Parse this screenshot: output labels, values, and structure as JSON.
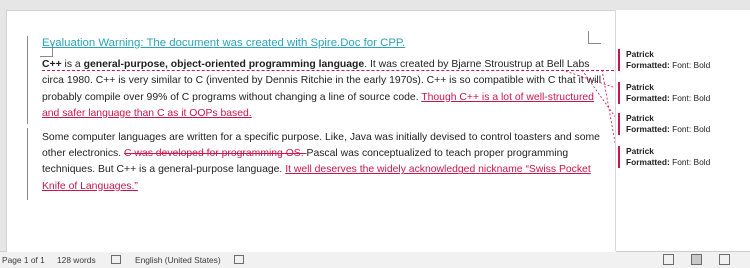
{
  "document": {
    "warning": "Evaluation Warning: The document was created with Spire.Doc for CPP.",
    "para1": {
      "bold_lead": "C++",
      "t1": " is a ",
      "bold_phrase": "general-purpose, object-oriented programming language",
      "t2": ". It was created by Bjarne Stroustrup at Bell Labs circa 1980. C++ is very similar to C (invented by Dennis Ritchie in the early 1970s). C++ is so compatible with C that it will probably compile over 99% of C programs without changing a line of source code. ",
      "inserted": "Though C++ is a lot of well-structured and safer language than C as it OOPs based."
    },
    "para2": {
      "t1": "Some computer languages are written for a specific purpose. Like, Java was initially devised to control toasters and some other electronics. ",
      "deleted": "C was developed for programming OS. ",
      "t2": "Pascal was conceptualized to teach proper programming techniques. But C++ is a general-purpose language. ",
      "inserted": "It well deserves the widely acknowledged nickname “Swiss Pocket Knife of Languages.”"
    }
  },
  "balloons": [
    {
      "author": "Patrick",
      "label": "Formatted:",
      "detail": " Font: Bold"
    },
    {
      "author": "Patrick",
      "label": "Formatted:",
      "detail": " Font: Bold"
    },
    {
      "author": "Patrick",
      "label": "Formatted:",
      "detail": " Font: Bold"
    },
    {
      "author": "Patrick",
      "label": "Formatted:",
      "detail": " Font: Bold"
    }
  ],
  "status_bar": {
    "page": "Page 1 of 1",
    "words": "128 words",
    "language": "English (United States)"
  },
  "colors": {
    "revision": "#c8174a",
    "warning": "#2ba3b8"
  }
}
